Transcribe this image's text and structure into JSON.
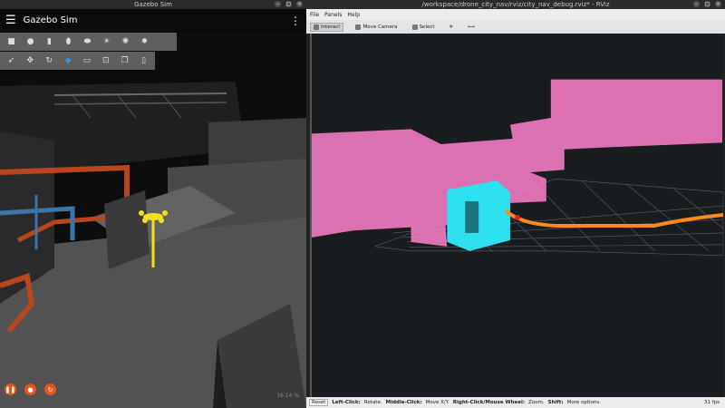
{
  "gazebo": {
    "window_title": "Gazebo Sim",
    "app_title": "Gazebo Sim",
    "toolbar_row1_icons": [
      "box-icon",
      "sphere-icon",
      "cylinder-icon",
      "capsule-icon",
      "ellipsoid-icon",
      "sun-icon",
      "light-icon",
      "spotlight-icon"
    ],
    "toolbar_row2_icons": [
      "select-icon",
      "translate-icon",
      "rotate-icon",
      "scale-icon",
      "camera-icon",
      "screenshot-icon",
      "copy-icon",
      "paste-icon"
    ],
    "controls": {
      "play": "❚❚",
      "step": "●",
      "reset": "↻"
    },
    "rtf": "16.14 %"
  },
  "rviz": {
    "window_title": "/workspace/drone_city_nav/rviz/city_nav_debug.rviz* - RViz",
    "menu": [
      "File",
      "Panels",
      "Help"
    ],
    "tools": [
      "Interact",
      "Move Camera",
      "Select"
    ],
    "status": {
      "reset": "Reset",
      "left_label": "Left-Click:",
      "left_text": "Rotate.",
      "middle_label": "Middle-Click:",
      "middle_text": "Move X/Y.",
      "right_label": "Right-Click/Mouse Wheel:",
      "right_text": "Zoom.",
      "shift_label": "Shift:",
      "shift_text": "More options.",
      "fps": "31 fps"
    }
  },
  "colors": {
    "accent": "#e2571b",
    "cloud": "#f07bc0",
    "cube": "#2ee0f0",
    "path": "#ff8a1a"
  }
}
